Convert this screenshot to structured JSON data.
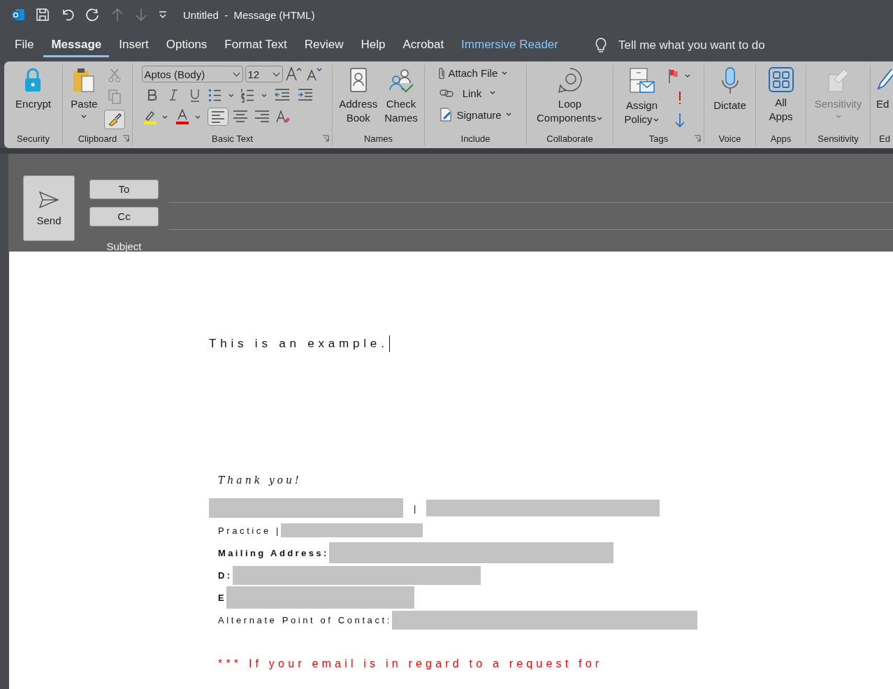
{
  "title_bar": {
    "title": "Untitled  -  Message (HTML)"
  },
  "menu_tabs": [
    {
      "label": "File",
      "selected": false,
      "kind": "plain"
    },
    {
      "label": "Message",
      "selected": true,
      "kind": "plain"
    },
    {
      "label": "Insert",
      "selected": false,
      "kind": "plain"
    },
    {
      "label": "Options",
      "selected": false,
      "kind": "plain"
    },
    {
      "label": "Format Text",
      "selected": false,
      "kind": "plain"
    },
    {
      "label": "Review",
      "selected": false,
      "kind": "plain"
    },
    {
      "label": "Help",
      "selected": false,
      "kind": "plain"
    },
    {
      "label": "Acrobat",
      "selected": false,
      "kind": "plain"
    },
    {
      "label": "Immersive Reader",
      "selected": false,
      "kind": "accent"
    }
  ],
  "tell_me": {
    "placeholder": "Tell me what you want to do"
  },
  "ribbon": {
    "groups": [
      {
        "label": "Security",
        "items": [
          {
            "label": [
              "Encrypt"
            ]
          }
        ]
      },
      {
        "label": "Clipboard",
        "items": [
          {
            "label": [
              "Paste"
            ]
          }
        ],
        "format_painter_on": true
      },
      {
        "label": "Basic Text",
        "font": "Aptos (Body)",
        "size": "12",
        "align_left_on": true
      },
      {
        "label": "Names",
        "items": [
          {
            "label": [
              "Address",
              "Book"
            ]
          },
          {
            "label": [
              "Check",
              "Names"
            ]
          }
        ]
      },
      {
        "label": "Include",
        "items": [
          {
            "label": [
              "Attach File"
            ]
          },
          {
            "label": [
              "Link"
            ]
          },
          {
            "label": [
              "Signature"
            ]
          }
        ]
      },
      {
        "label": "Collaborate",
        "items": [
          {
            "label": [
              "Loop",
              "Components"
            ]
          }
        ]
      },
      {
        "label": "Tags",
        "items": [
          {
            "label": [
              "Assign",
              "Policy"
            ]
          }
        ]
      },
      {
        "label": "Voice",
        "items": [
          {
            "label": [
              "Dictate"
            ]
          }
        ]
      },
      {
        "label": "Apps",
        "items": [
          {
            "label": [
              "All",
              "Apps"
            ]
          }
        ]
      },
      {
        "label": "Sensitivity",
        "items": [
          {
            "label": [
              "Sensitivity"
            ],
            "disabled": true
          }
        ]
      },
      {
        "label": "Ed",
        "items": [
          {
            "label": [
              "Ed"
            ]
          }
        ]
      }
    ]
  },
  "compose": {
    "send": "Send",
    "to": "To",
    "cc": "Cc",
    "subject": "Subject"
  },
  "body": {
    "text": "This is an example.",
    "closing": "Thank you!",
    "signature": [
      {
        "parts": [
          {
            "kind": "redacted"
          },
          {
            "kind": "text",
            "text": "|",
            "bold": false
          },
          {
            "kind": "redacted"
          }
        ]
      },
      {
        "parts": [
          {
            "kind": "text",
            "text": "Practice |",
            "bold": false
          },
          {
            "kind": "redacted"
          }
        ]
      },
      {
        "parts": [
          {
            "kind": "text",
            "text": "Mailing Address:",
            "bold": true
          },
          {
            "kind": "redacted"
          }
        ]
      },
      {
        "parts": [
          {
            "kind": "text",
            "text": "D:",
            "bold": true
          },
          {
            "kind": "redacted"
          }
        ]
      },
      {
        "parts": [
          {
            "kind": "text",
            "text": "E",
            "bold": true
          },
          {
            "kind": "redacted"
          }
        ]
      },
      {
        "parts": [
          {
            "kind": "text",
            "text": "Alternate Point of Contact:",
            "bold": false
          },
          {
            "kind": "redacted"
          }
        ]
      }
    ],
    "notice": "*** If your email is in regard to a request for"
  }
}
